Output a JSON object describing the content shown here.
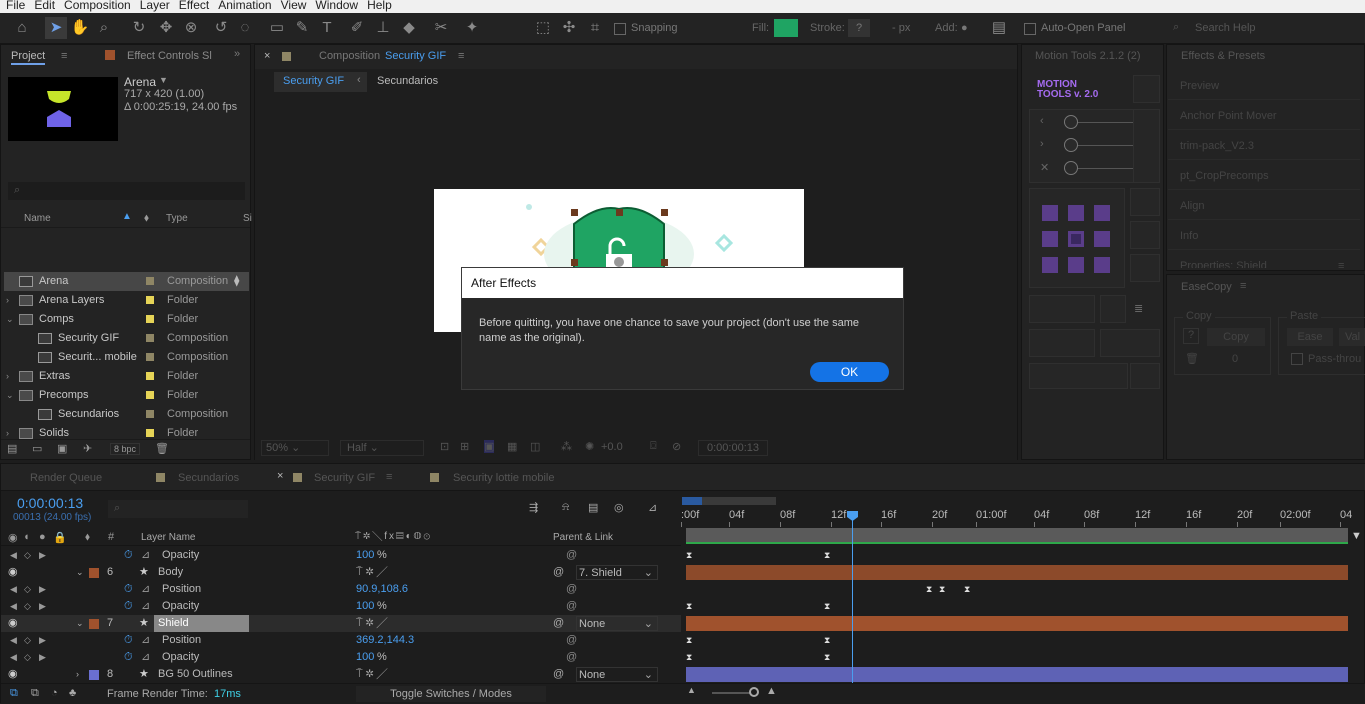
{
  "menu": [
    "File",
    "Edit",
    "Composition",
    "Layer",
    "Effect",
    "Animation",
    "View",
    "Window",
    "Help"
  ],
  "toolbar": {
    "snapping_label": "Snapping",
    "fill_label": "Fill:",
    "stroke_label": "Stroke:",
    "stroke_value": "?",
    "px_label": "- px",
    "add_label": "Add:",
    "auto_open_label": "Auto-Open Panel",
    "search_help_placeholder": "Search Help",
    "fill_color": "#1fa463"
  },
  "project": {
    "tab_project": "Project",
    "tab_effect_controls": "Effect Controls Sl",
    "item_name": "Arena",
    "item_res": "717 x 420 (1.00)",
    "item_dur": "Δ 0:00:25:19, 24.00 fps",
    "col_name": "Name",
    "col_type": "Type",
    "col_size": "Si",
    "items": [
      {
        "name": "Arena",
        "type": "Composition",
        "kind": "comp",
        "swatch": "#8f8665",
        "level": 0,
        "expand": "",
        "selected": true
      },
      {
        "name": "Arena Layers",
        "type": "Folder",
        "kind": "folder",
        "swatch": "#e6d457",
        "level": 0,
        "expand": "›"
      },
      {
        "name": "Comps",
        "type": "Folder",
        "kind": "folder",
        "swatch": "#e6d457",
        "level": 0,
        "expand": "⌄"
      },
      {
        "name": "Security GIF",
        "type": "Composition",
        "kind": "comp",
        "swatch": "#8f8665",
        "level": 1,
        "expand": ""
      },
      {
        "name": "Securit... mobile",
        "type": "Composition",
        "kind": "comp",
        "swatch": "#8f8665",
        "level": 1,
        "expand": ""
      },
      {
        "name": "Extras",
        "type": "Folder",
        "kind": "folder",
        "swatch": "#e6d457",
        "level": 0,
        "expand": "›"
      },
      {
        "name": "Precomps",
        "type": "Folder",
        "kind": "folder",
        "swatch": "#e6d457",
        "level": 0,
        "expand": "⌄"
      },
      {
        "name": "Secundarios",
        "type": "Composition",
        "kind": "comp",
        "swatch": "#8f8665",
        "level": 1,
        "expand": ""
      },
      {
        "name": "Solids",
        "type": "Folder",
        "kind": "folder",
        "swatch": "#e6d457",
        "level": 0,
        "expand": "›"
      }
    ],
    "bpc": "8 bpc"
  },
  "composition": {
    "tab_prefix": "Composition",
    "tab_name": "Security GIF",
    "crumb_active": "Security GIF",
    "crumb_next": "Secundarios",
    "zoom": "50%",
    "quality": "Half",
    "exposure": "+0.0",
    "timecode": "0:00:00:13"
  },
  "dialog": {
    "title": "After Effects",
    "message": "Before quitting, you have one chance to save your project (don't use the same name as the original).",
    "ok_label": "OK"
  },
  "motion_tools": {
    "tab": "Motion Tools 2.1.2 (2)",
    "logo_line1": "MOTION",
    "logo_line2": "TOOLS v. 2.0"
  },
  "right_panel": {
    "tab_effects": "Effects & Presets",
    "items": [
      "Preview",
      "Anchor Point Mover",
      "trim-pack_V2.3",
      "pt_CropPrecomps",
      "Align",
      "Info",
      "Properties: Shield"
    ],
    "easecopy": "EaseCopy",
    "copy_label": "Copy",
    "copy_btn": "Copy",
    "paste_label": "Paste",
    "ease_btn": "Ease",
    "val_btn": "Val",
    "zero": "0",
    "pass_through": "Pass-throu"
  },
  "timeline": {
    "tab_render": "Render Queue",
    "tab_secundarios": "Secundarios",
    "tab_security": "Security GIF",
    "tab_lottie": "Security lottie mobile",
    "timecode": "0:00:00:13",
    "frames": "00013 (24.00 fps)",
    "col_layer_name": "Layer Name",
    "col_parent": "Parent & Link",
    "ruler": [
      ":00f",
      "04f",
      "08f",
      "12f",
      "16f",
      "20f",
      "01:00f",
      "04f",
      "08f",
      "12f",
      "16f",
      "20f",
      "02:00f",
      "04"
    ],
    "rows": [
      {
        "kind": "prop",
        "name": "Opacity",
        "value": "100",
        "unit": "%"
      },
      {
        "kind": "layer",
        "num": "6",
        "name": "Body",
        "parent": "7. Shield",
        "color": "#a0522d"
      },
      {
        "kind": "prop",
        "name": "Position",
        "value": "90.9,108.6",
        "unit": ""
      },
      {
        "kind": "prop",
        "name": "Opacity",
        "value": "100",
        "unit": "%"
      },
      {
        "kind": "layer",
        "num": "7",
        "name": "Shield",
        "parent": "None",
        "color": "#a0522d",
        "selected": true
      },
      {
        "kind": "prop",
        "name": "Position",
        "value": "369.2,144.3",
        "unit": ""
      },
      {
        "kind": "prop",
        "name": "Opacity",
        "value": "100",
        "unit": "%"
      },
      {
        "kind": "layer",
        "num": "8",
        "name": "BG 50 Outlines",
        "parent": "None",
        "color": "#6a6fd0"
      }
    ],
    "frame_render_label": "Frame Render Time:",
    "frame_render_value": "17ms",
    "toggle_label": "Toggle Switches / Modes"
  }
}
